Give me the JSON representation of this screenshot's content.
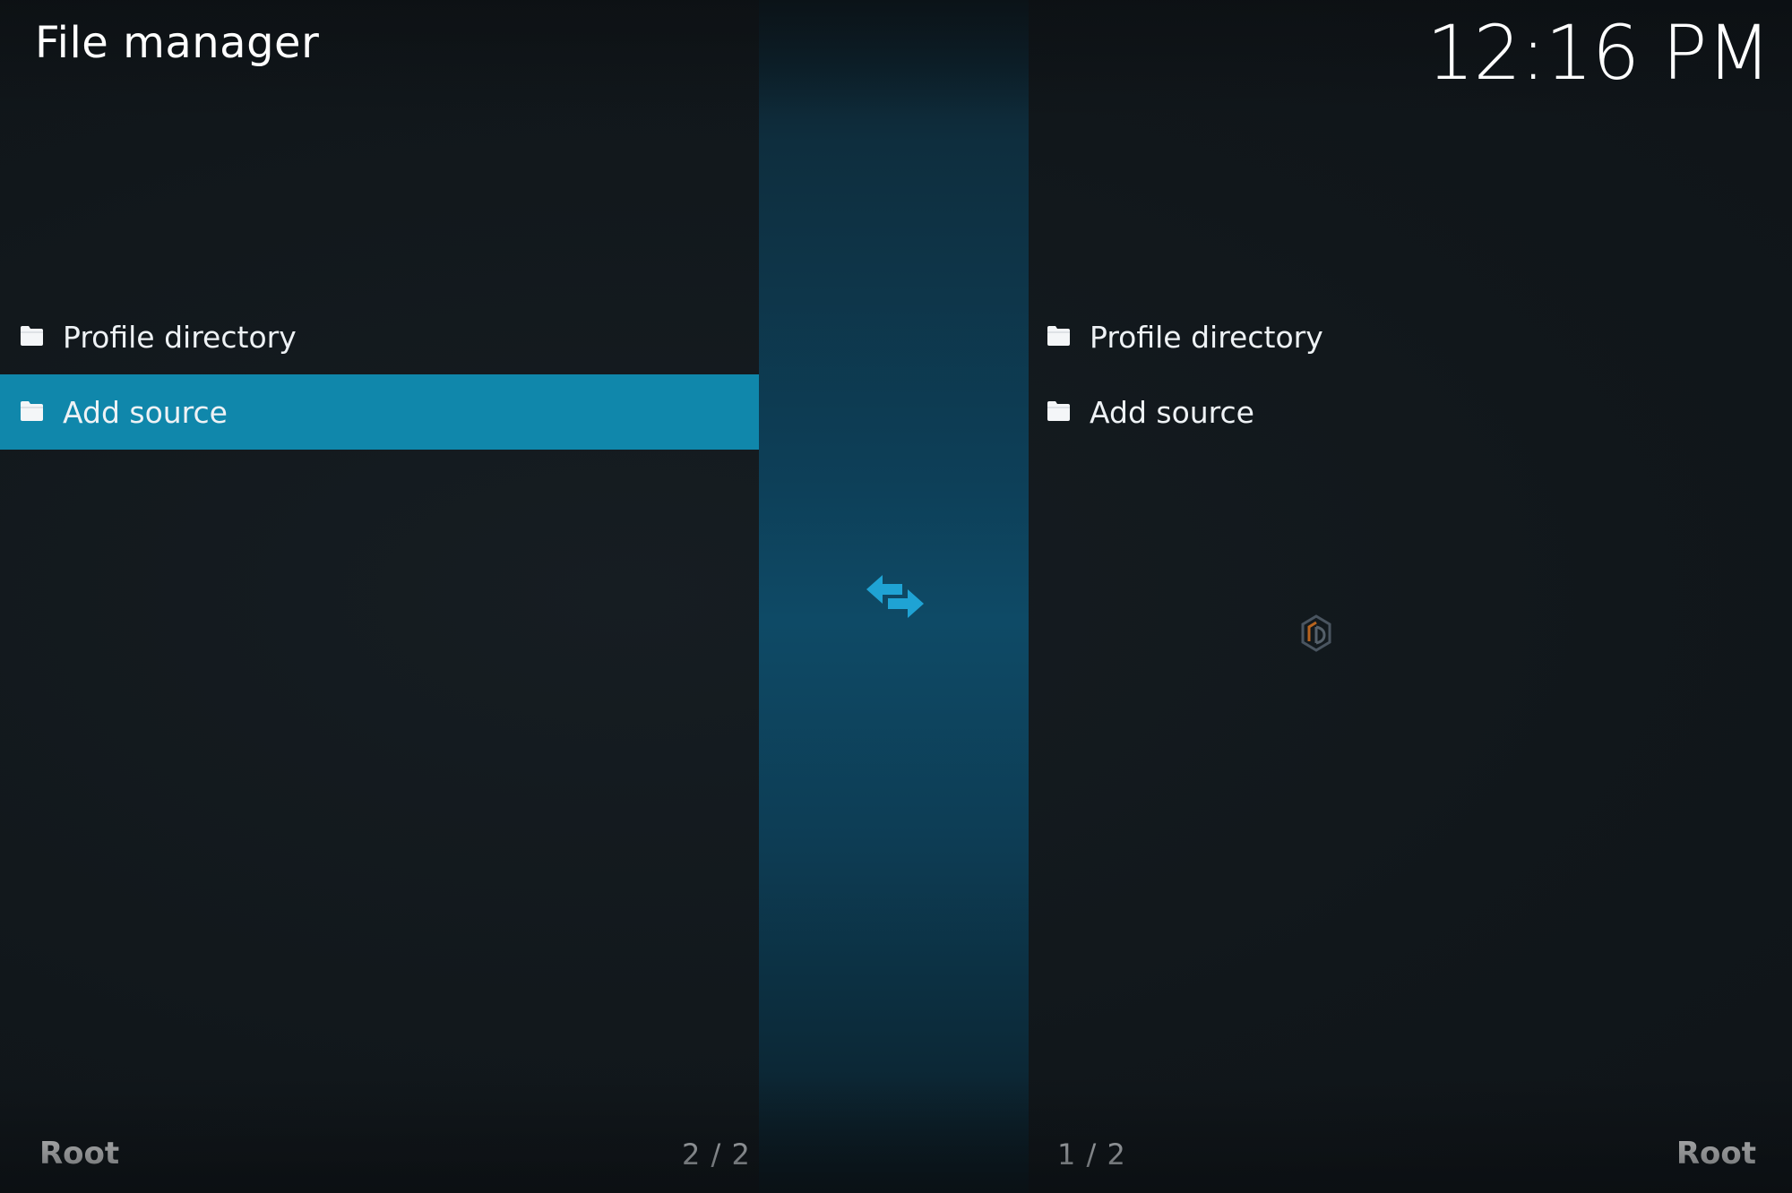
{
  "header": {
    "title": "File manager",
    "clock": "12:16 PM"
  },
  "left_panel": {
    "items": [
      {
        "label": "Profile directory",
        "icon": "folder-icon",
        "selected": false
      },
      {
        "label": "Add source",
        "icon": "folder-icon",
        "selected": true
      }
    ],
    "footer": {
      "path": "Root",
      "count": "2 / 2"
    }
  },
  "right_panel": {
    "items": [
      {
        "label": "Profile directory",
        "icon": "folder-icon",
        "selected": false
      },
      {
        "label": "Add source",
        "icon": "folder-icon",
        "selected": false
      }
    ],
    "footer": {
      "path": "Root",
      "count": "1 / 2"
    }
  },
  "center": {
    "icon": "swap-arrows-icon"
  },
  "colors": {
    "selection": "#1087ab",
    "accent": "#1fa3d4",
    "background": "#12181d"
  }
}
